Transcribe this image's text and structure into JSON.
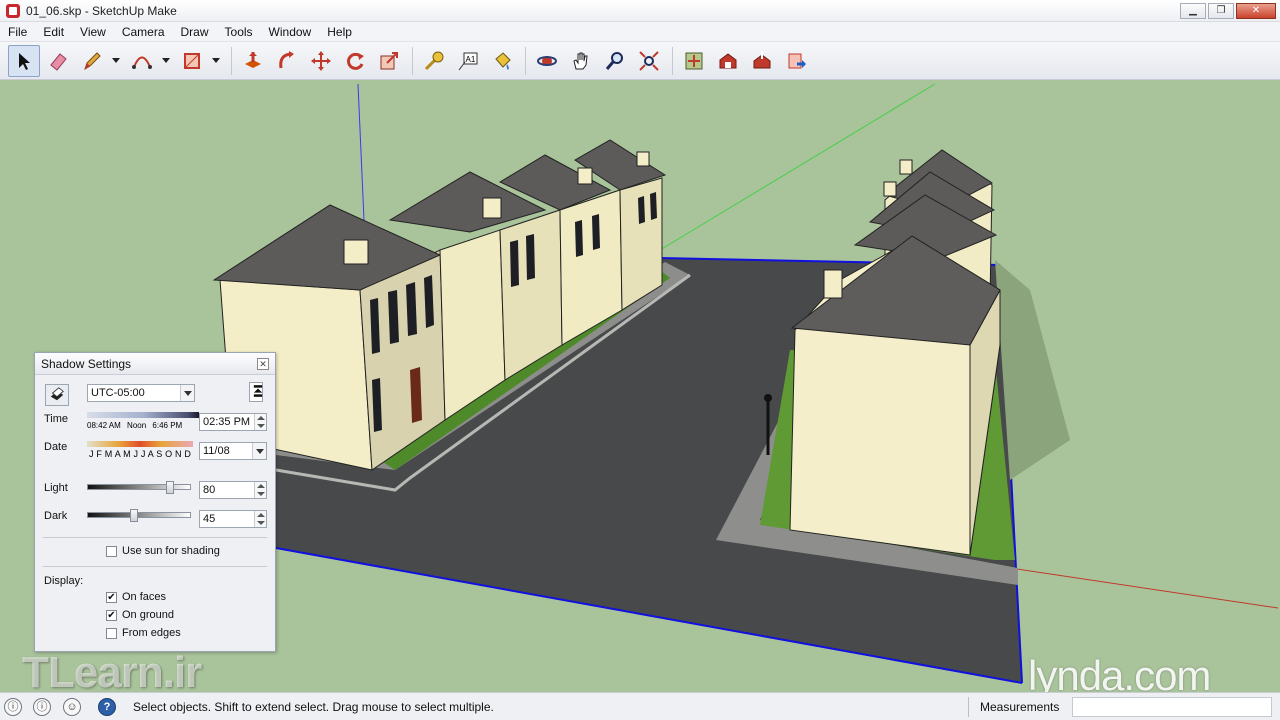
{
  "window": {
    "title": "01_06.skp - SketchUp Make"
  },
  "menu": [
    "File",
    "Edit",
    "View",
    "Camera",
    "Draw",
    "Tools",
    "Window",
    "Help"
  ],
  "toolbar": {
    "tools": [
      "select-tool",
      "eraser-tool",
      "pencil-tool",
      "arc-tool",
      "rectangle-tool",
      "push-pull-tool",
      "follow-me-tool",
      "move-tool",
      "rotate-tool",
      "scale-tool",
      "tape-measure-tool",
      "text-tool",
      "paint-bucket-tool",
      "orbit-tool",
      "pan-tool",
      "zoom-tool",
      "zoom-extents-tool",
      "warehouse-tool",
      "share-model-tool",
      "extension-warehouse-tool",
      "send-to-layout-tool"
    ]
  },
  "shadow_settings": {
    "title": "Shadow Settings",
    "timezone": "UTC-05:00",
    "time_label": "Time",
    "time_sunrise": "08:42 AM",
    "time_noon": "Noon",
    "time_sunset": "6:46 PM",
    "time_value": "02:35 PM",
    "date_label": "Date",
    "months": "J F M A M J J A S O N D",
    "date_value": "11/08",
    "light_label": "Light",
    "light_value": "80",
    "light_level": 0.8,
    "dark_label": "Dark",
    "dark_value": "45",
    "dark_level": 0.45,
    "use_sun_label": "Use sun for shading",
    "use_sun_checked": false,
    "display_label": "Display:",
    "on_faces_label": "On faces",
    "on_faces_checked": true,
    "on_ground_label": "On ground",
    "on_ground_checked": true,
    "from_edges_label": "From edges",
    "from_edges_checked": false
  },
  "status": {
    "message": "Select objects. Shift to extend select. Drag mouse to select multiple.",
    "measurements_label": "Measurements",
    "measurements_value": ""
  },
  "watermarks": {
    "left": "TLearn.ir",
    "right": "lynda.com"
  },
  "colors": {
    "ground": "#a9c39b",
    "road": "#4a4b4d",
    "wall": "#f2edc6",
    "roof": "#5d5b5a",
    "axis_red": "#c0392b",
    "axis_green": "#3cc43c",
    "axis_blue": "#2a2ae0"
  }
}
